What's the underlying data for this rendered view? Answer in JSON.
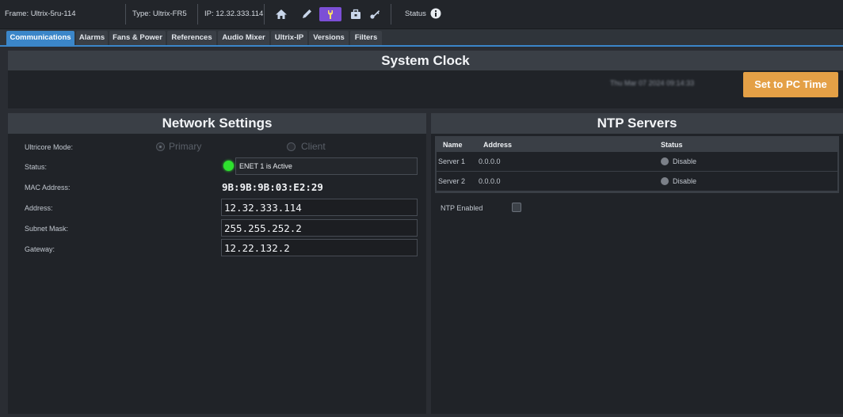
{
  "topbar": {
    "frame": "Frame: Ultrix-5ru-114",
    "type": "Type: Ultrix-FR5",
    "ip": "IP: 12.32.333.114",
    "status": "Status",
    "icons": [
      "home-icon",
      "pencil-icon",
      "wrench-icon",
      "toolbox-icon",
      "key-icon",
      "info-icon"
    ],
    "accent": "#7c4fd6"
  },
  "tabs": [
    {
      "label": "Communications",
      "active": true
    },
    {
      "label": "Alarms"
    },
    {
      "label": "Fans & Power"
    },
    {
      "label": "References"
    },
    {
      "label": "Audio Mixer"
    },
    {
      "label": "Ultrix-IP"
    },
    {
      "label": "Versions"
    },
    {
      "label": "Filters"
    }
  ],
  "system_clock": {
    "title": "System Clock",
    "time_text": "Thu Mar 07 2024 09:14:33",
    "button_label": "Set to PC Time",
    "button_color": "#e4a046"
  },
  "network": {
    "title": "Network Settings",
    "mode_label": "Ultricore Mode:",
    "mode_primary": "Primary",
    "mode_client": "Client",
    "status_label": "Status:",
    "status_value": "ENET 1 is Active",
    "status_color": "#2ee12e",
    "mac_label": "MAC Address:",
    "mac_value": "9B:9B:9B:03:E2:29",
    "address_label": "Address:",
    "address_value": "12.32.333.114",
    "subnet_label": "Subnet Mask:",
    "subnet_value": "255.255.252.2",
    "gateway_label": "Gateway:",
    "gateway_value": "12.22.132.2"
  },
  "ntp": {
    "title": "NTP Servers",
    "columns": [
      "Name",
      "Address",
      "Status"
    ],
    "rows": [
      {
        "name": "Server 1",
        "address": "0.0.0.0",
        "status": "Disable"
      },
      {
        "name": "Server 2",
        "address": "0.0.0.0",
        "status": "Disable"
      }
    ],
    "enabled_label": "NTP Enabled"
  }
}
